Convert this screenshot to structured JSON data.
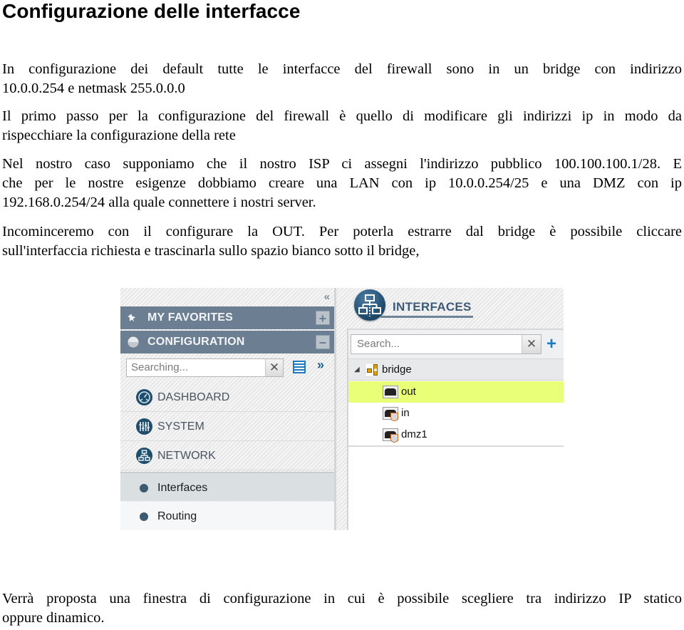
{
  "document": {
    "title": "Configurazione delle interfacce",
    "paragraphs": {
      "p1": {
        "line1": "In configurazione dei default tutte le interfacce del firewall sono in un bridge con indirizzo",
        "line2": "10.0.0.254 e netmask 255.0.0.0"
      },
      "p2": {
        "line1": "Il primo passo per la configurazione del firewall è quello di modificare gli indirizzi ip in modo da",
        "line2": "rispecchiare la configurazione della rete"
      },
      "p3": {
        "line1": "Nel nostro caso supponiamo che il nostro ISP ci assegni l'indirizzo pubblico 100.100.100.1/28. E",
        "line2": "che per le nostre esigenze dobbiamo creare una LAN con ip 10.0.0.254/25 e una DMZ con ip",
        "line3": "192.168.0.254/24 alla quale connettere i nostri server."
      },
      "p4": {
        "line1": "Incominceremo con il configurare la OUT. Per poterla estrarre dal bridge è possibile cliccare",
        "line2": "sull'interfaccia richiesta e trascinarla sullo spazio bianco sotto il bridge,"
      },
      "p5": {
        "line1": "Verrà proposta una finestra di configurazione in cui è possibile scegliere tra indirizzo IP statico",
        "line2": "oppure dinamico."
      }
    }
  },
  "screenshot": {
    "sidebar": {
      "collapse_icon": "«",
      "sections": [
        {
          "label": "MY FAVORITES",
          "icon": "pin-icon",
          "button": "+"
        },
        {
          "label": "CONFIGURATION",
          "icon": "circle-icon",
          "button": "−"
        }
      ],
      "search": {
        "placeholder": "Searching...",
        "clear": "✕"
      },
      "expand_icon": "»",
      "menu": [
        {
          "label": "DASHBOARD",
          "icon": "dashboard-icon"
        },
        {
          "label": "SYSTEM",
          "icon": "sliders-icon"
        },
        {
          "label": "NETWORK",
          "icon": "network-icon"
        }
      ],
      "submenu": [
        {
          "label": "Interfaces",
          "selected": true
        },
        {
          "label": "Routing",
          "selected": false
        }
      ]
    },
    "panel": {
      "title": "INTERFACES",
      "search": {
        "placeholder": "Search...",
        "clear": "✕"
      },
      "add_icon": "+",
      "tree": {
        "root": {
          "label": "bridge",
          "expanded": true,
          "twisty": "◢"
        },
        "children": [
          {
            "label": "out",
            "highlighted": true
          },
          {
            "label": "in",
            "highlighted": false
          },
          {
            "label": "dmz1",
            "highlighted": false
          }
        ]
      },
      "colors": {
        "highlight": "#eaff78",
        "accent": "#1f7bbf",
        "header": "#6c7f92"
      }
    }
  }
}
